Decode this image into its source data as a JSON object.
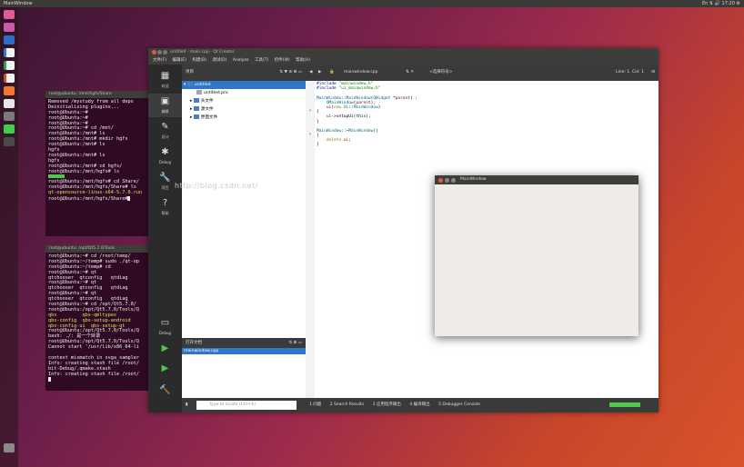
{
  "topbar": {
    "title": "MainWindow",
    "status": "En  ⇅  🔊  17:20 ⚙"
  },
  "launcher": {
    "icons": [
      "terminal-icon",
      "files-icon",
      "firefox-icon",
      "writer-icon",
      "calc-icon",
      "impress-icon",
      "software-icon",
      "amazon-icon",
      "settings-icon",
      "qtcreator-icon",
      "terminal2-icon",
      "trash-icon"
    ]
  },
  "term1": {
    "title": "root@ubuntu: /mnt/hgfs/Share",
    "lines": [
      "Removed /mystudy from all deps",
      "Deinitializing plugins...",
      "root@Ubuntu:~#",
      "root@Ubuntu:~#",
      "root@Ubuntu:~#",
      "root@Ubuntu:~# cd /mnt/",
      "root@Ubuntu:/mnt# ls",
      "root@Ubuntu:/mnt# mkdir hgfs",
      "root@Ubuntu:/mnt# ls",
      "hgfs",
      "root@Ubuntu:/mnt# ls",
      "hgfs",
      "root@Ubuntu:/mnt# cd hgfs/",
      "root@Ubuntu:/mnt/hgfs# ls",
      "",
      "root@Ubuntu:/mnt/hgfs# cd Share/",
      "root@Ubuntu:/mnt/hgfs/Share# ls",
      "qt-opensource-linux-x64-5.7.0.run",
      "root@Ubuntu:/mnt/hgfs/Share#"
    ]
  },
  "term2": {
    "title": "root@ubuntu: /opt/Qt5.7.0/Tools",
    "lines": [
      "root@Ubuntu:~# cd /root/temp/",
      "root@Ubuntu:~/temp# sudo ./qt-op",
      "root@Ubuntu:~/temp# cd",
      "root@Ubuntu:~# qt",
      "qtchooser  qtconfig   qtdiag",
      "root@Ubuntu:~# qt",
      "qtchooser  qtconfig   qtdiag",
      "root@Ubuntu:~# qt",
      "qtchooser  qtconfig   qtdiag",
      "root@Ubuntu:~# cd /opt/Qt5.7.0/",
      "root@Ubuntu:/opt/Qt5.7.0/Tools/Q",
      "qbs         qbs-qmltypes",
      "qbs-config  qbs-setup-android",
      "qbs-config-ui  qbs-setup-qt",
      "root@Ubuntu:/opt/Qt5.7.0/Tools/Q",
      "bash: ./: 是一个目录",
      "root@Ubuntu:/opt/Qt5.7.0/Tools/Q",
      "Cannot start '/usr/lib/x86_64-li",
      "",
      "context mismatch in svga_sampler",
      "Info: creating stash file /root/",
      "bit-Debug/.qmake.stash",
      "Info: creating stash file /root/",
      ""
    ]
  },
  "qt": {
    "title": "untitled - main.cpp - Qt Creator",
    "menu": [
      "文件(F)",
      "编辑(E)",
      "构建(B)",
      "调试(D)",
      "Analyze",
      "工具(T)",
      "控件(W)",
      "帮助(H)"
    ],
    "modes": [
      {
        "label": "欢迎",
        "icon": "▦"
      },
      {
        "label": "编辑",
        "icon": "▣"
      },
      {
        "label": "设计",
        "icon": "✎"
      },
      {
        "label": "Debug",
        "icon": "✱"
      },
      {
        "label": "项目",
        "icon": "🔧"
      },
      {
        "label": "帮助",
        "icon": "?"
      }
    ],
    "bottom_modes": [
      {
        "label": "Debug",
        "icon": "▭"
      },
      {
        "label": "",
        "icon": "▶"
      },
      {
        "label": "",
        "icon": "▶"
      },
      {
        "label": "",
        "icon": "🔨"
      }
    ],
    "project": {
      "header": "项目",
      "tree": [
        {
          "label": "untitled",
          "indent": 0,
          "selected": true
        },
        {
          "label": "untitled.pro",
          "indent": 2,
          "selected": false
        },
        {
          "label": "头文件",
          "indent": 1,
          "selected": false
        },
        {
          "label": "源文件",
          "indent": 1,
          "selected": false
        },
        {
          "label": "界面文件",
          "indent": 1,
          "selected": false
        }
      ]
    },
    "open_docs": {
      "header": "打开文档",
      "items": [
        "mainwindow.cpp"
      ]
    },
    "editor": {
      "file": "mainwindow.cpp",
      "symbol": "<选择符号>",
      "position": "Line: 1, Col: 1",
      "lines": [
        "#include \"mainwindow.h\"",
        "#include \"ui_mainwindow.h\"",
        "",
        "MainWindow::MainWindow(QWidget *parent) :",
        "    QMainWindow(parent),",
        "    ui(new Ui::MainWindow)",
        "{",
        "    ui->setupUi(this);",
        "}",
        "",
        "MainWindow::~MainWindow()",
        "{",
        "    delete ui;",
        "}"
      ]
    },
    "watermark": "http://blog.csdn.net/",
    "locator_placeholder": "Type to locate (Ctrl+K)",
    "output_tabs": [
      "1 问题",
      "2 Search Results",
      "3 应用程序输出",
      "4 编译输出",
      "5 Debugger Console"
    ]
  },
  "mainwindow": {
    "title": "MainWindow"
  }
}
